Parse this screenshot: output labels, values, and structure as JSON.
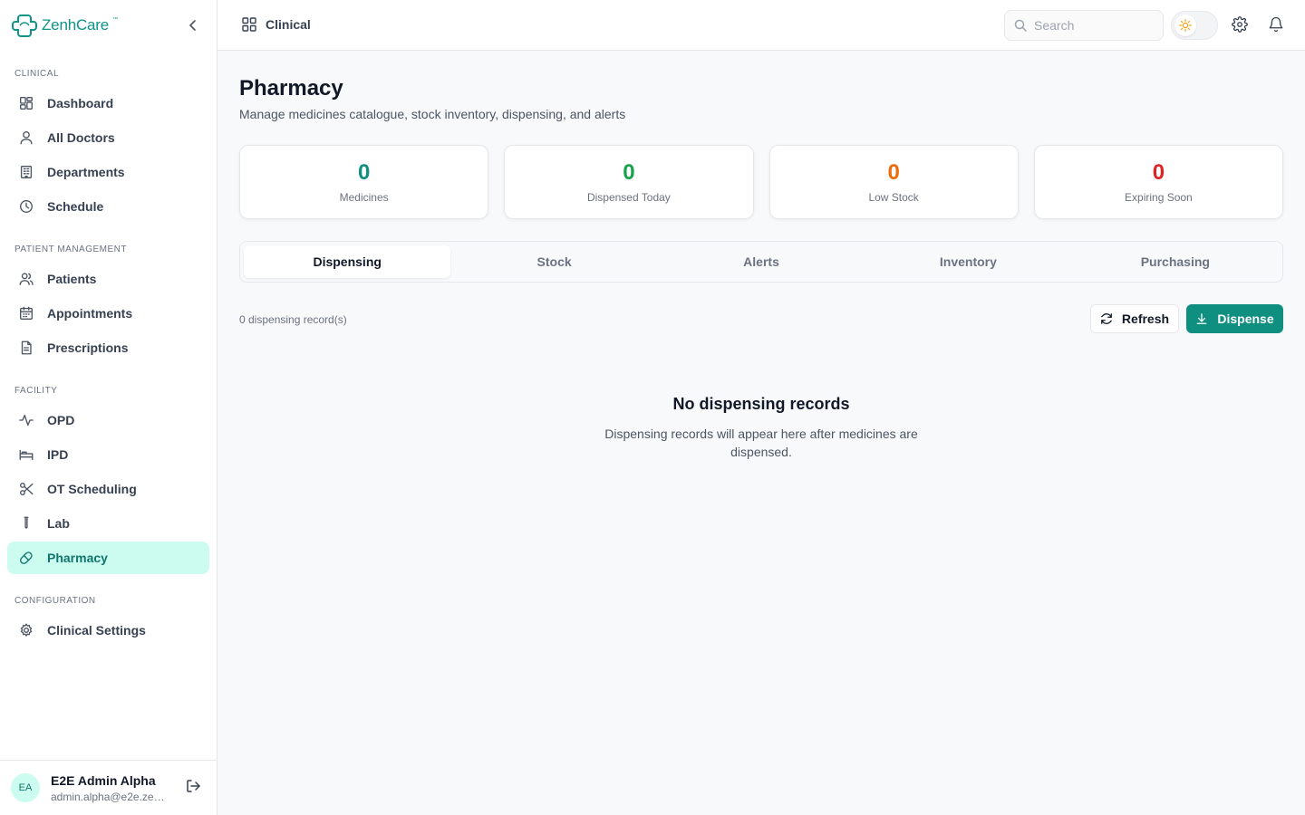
{
  "brand": {
    "name": "ZenhCare",
    "tm": "™"
  },
  "sidebar": {
    "sections": [
      {
        "title": "CLINICAL",
        "items": [
          {
            "label": "Dashboard",
            "icon": "grid-icon"
          },
          {
            "label": "All Doctors",
            "icon": "user-icon"
          },
          {
            "label": "Departments",
            "icon": "building-icon"
          },
          {
            "label": "Schedule",
            "icon": "clock-icon"
          }
        ]
      },
      {
        "title": "PATIENT MANAGEMENT",
        "items": [
          {
            "label": "Patients",
            "icon": "users-icon"
          },
          {
            "label": "Appointments",
            "icon": "calendar-icon"
          },
          {
            "label": "Prescriptions",
            "icon": "file-icon"
          }
        ]
      },
      {
        "title": "FACILITY",
        "items": [
          {
            "label": "OPD",
            "icon": "activity-icon"
          },
          {
            "label": "IPD",
            "icon": "bed-icon"
          },
          {
            "label": "OT Scheduling",
            "icon": "scissors-icon"
          },
          {
            "label": "Lab",
            "icon": "test-tube-icon"
          },
          {
            "label": "Pharmacy",
            "icon": "pill-icon",
            "active": true
          }
        ]
      },
      {
        "title": "CONFIGURATION",
        "items": [
          {
            "label": "Clinical Settings",
            "icon": "gear-icon"
          }
        ]
      }
    ]
  },
  "user": {
    "initials": "EA",
    "name": "E2E Admin Alpha",
    "email": "admin.alpha@e2e.zen..."
  },
  "header": {
    "breadcrumb": "Clinical",
    "search_placeholder": "Search"
  },
  "page": {
    "title": "Pharmacy",
    "subtitle": "Manage medicines catalogue, stock inventory, dispensing, and alerts"
  },
  "stats": [
    {
      "value": "0",
      "label": "Medicines",
      "color": "#0f8f80"
    },
    {
      "value": "0",
      "label": "Dispensed Today",
      "color": "#16a34a"
    },
    {
      "value": "0",
      "label": "Low Stock",
      "color": "#ea6c0a"
    },
    {
      "value": "0",
      "label": "Expiring Soon",
      "color": "#dc2626"
    }
  ],
  "tabs": [
    "Dispensing",
    "Stock",
    "Alerts",
    "Inventory",
    "Purchasing"
  ],
  "active_tab": "Dispensing",
  "toolbar": {
    "record_count": "0 dispensing record(s)",
    "refresh_label": "Refresh",
    "dispense_label": "Dispense"
  },
  "empty_state": {
    "title": "No dispensing records",
    "description": "Dispensing records will appear here after medicines are dispensed."
  },
  "colors": {
    "accent": "#0f8f80",
    "active_nav_bg": "#ccfbef"
  }
}
